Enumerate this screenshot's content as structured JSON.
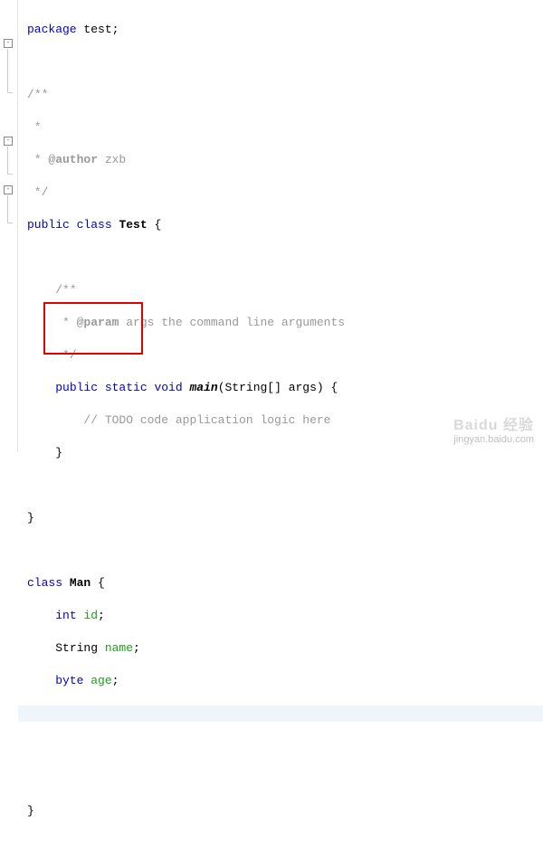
{
  "code": {
    "l1_pkg": "package",
    "l1_name": " test;",
    "l3_c": "/**",
    "l4_c": " *",
    "l5_c": " * ",
    "l5_tag": "@author",
    "l5_author": " zxb",
    "l6_c": " */",
    "l7_pub": "public",
    "l7_cls": " class",
    "l7_name": "Test",
    "l7_brace": " {",
    "l9_c": "/**",
    "l10_c": " * ",
    "l10_tag": "@param",
    "l10_p": " args ",
    "l10_desc": "the command line arguments",
    "l11_c": " */",
    "l12_pub": "public",
    "l12_st": " static",
    "l12_void": " void",
    "l12_main": "main",
    "l12_args": "(String[] args) {",
    "l13_c": "// TODO code application logic here",
    "l14": "}",
    "l16": "}",
    "l18_cls": "class",
    "l18_name": "Man",
    "l18_brace": " {",
    "l19_t": "int",
    "l19_n": " id",
    "l19_s": ";",
    "l20_t": "String ",
    "l20_n": "name",
    "l20_s": ";",
    "l21_t": "byte",
    "l21_n": " age",
    "l21_s": ";",
    "l25": "}"
  },
  "watermark": {
    "logo": "Baidu 经验",
    "url": "jingyan.baidu.com"
  }
}
